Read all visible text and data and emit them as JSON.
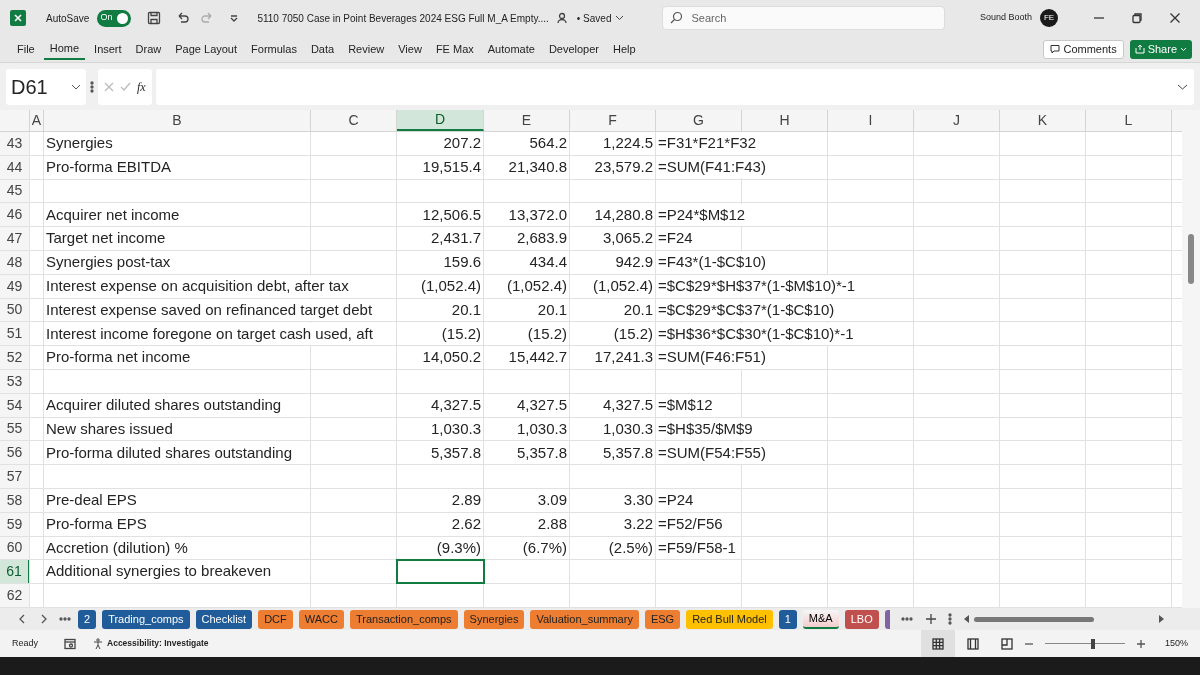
{
  "title_bar": {
    "autosave_label": "AutoSave",
    "autosave_toggle": {
      "label": "On",
      "on": true
    },
    "file_name": "5110 7050 Case in Point Beverages 2024 ESG Full M_A Empty....",
    "save_state": "• Saved",
    "search": {
      "placeholder": "Search"
    },
    "user_name": "Sound Booth",
    "avatar_initials": "FE"
  },
  "ribbon_tabs": [
    {
      "label": "File",
      "selected": false
    },
    {
      "label": "Home",
      "selected": true
    },
    {
      "label": "Insert",
      "selected": false
    },
    {
      "label": "Draw",
      "selected": false
    },
    {
      "label": "Page Layout",
      "selected": false
    },
    {
      "label": "Formulas",
      "selected": false
    },
    {
      "label": "Data",
      "selected": false
    },
    {
      "label": "Review",
      "selected": false
    },
    {
      "label": "View",
      "selected": false
    },
    {
      "label": "FE Max",
      "selected": false
    },
    {
      "label": "Automate",
      "selected": false
    },
    {
      "label": "Developer",
      "selected": false
    },
    {
      "label": "Help",
      "selected": false
    }
  ],
  "ribbon_buttons": {
    "comments": "Comments",
    "share": "Share"
  },
  "formula_bar": {
    "name_box": "D61",
    "fx": "fx"
  },
  "columns": [
    {
      "label": "A",
      "selected": false
    },
    {
      "label": "B",
      "selected": false
    },
    {
      "label": "C",
      "selected": false
    },
    {
      "label": "D",
      "selected": true
    },
    {
      "label": "E",
      "selected": false
    },
    {
      "label": "F",
      "selected": false
    },
    {
      "label": "G",
      "selected": false
    },
    {
      "label": "H",
      "selected": false
    },
    {
      "label": "I",
      "selected": false
    },
    {
      "label": "J",
      "selected": false
    },
    {
      "label": "K",
      "selected": false
    },
    {
      "label": "L",
      "selected": false
    }
  ],
  "rows": [
    {
      "number": "43",
      "selected": false,
      "b": "Synergies",
      "d": "207.2",
      "e": "564.2",
      "f": "1,224.5",
      "g": "=F31*F21*F32"
    },
    {
      "number": "44",
      "selected": false,
      "b": "Pro-forma EBITDA",
      "d": "19,515.4",
      "e": "21,340.8",
      "f": "23,579.2",
      "g": "=SUM(F41:F43)"
    },
    {
      "number": "45",
      "selected": false
    },
    {
      "number": "46",
      "selected": false,
      "b": "Acquirer net income",
      "d": "12,506.5",
      "e": "13,372.0",
      "f": "14,280.8",
      "g": "=P24*$M$12"
    },
    {
      "number": "47",
      "selected": false,
      "b": "Target net income",
      "d": "2,431.7",
      "e": "2,683.9",
      "f": "3,065.2",
      "g": "=F24"
    },
    {
      "number": "48",
      "selected": false,
      "b": "Synergies post-tax",
      "d": "159.6",
      "e": "434.4",
      "f": "942.9",
      "g": "=F43*(1-$C$10)"
    },
    {
      "number": "49",
      "selected": false,
      "b": "Interest expense on acquisition debt, after tax",
      "d": "(1,052.4)",
      "e": "(1,052.4)",
      "f": "(1,052.4)",
      "g": "=$C$29*$H$37*(1-$M$10)*-1"
    },
    {
      "number": "50",
      "selected": false,
      "b": "Interest expense saved on refinanced target debt",
      "d": "20.1",
      "e": "20.1",
      "f": "20.1",
      "g": "=$C$29*$C$37*(1-$C$10)"
    },
    {
      "number": "51",
      "selected": false,
      "b": "Interest income foregone on target cash used, aft",
      "d": "(15.2)",
      "e": "(15.2)",
      "f": "(15.2)",
      "g": "=$H$36*$C$30*(1-$C$10)*-1"
    },
    {
      "number": "52",
      "selected": false,
      "b": "Pro-forma net income",
      "d": "14,050.2",
      "e": "15,442.7",
      "f": "17,241.3",
      "g": "=SUM(F46:F51)"
    },
    {
      "number": "53",
      "selected": false
    },
    {
      "number": "54",
      "selected": false,
      "b": "Acquirer diluted shares outstanding",
      "d": "4,327.5",
      "e": "4,327.5",
      "f": "4,327.5",
      "g": "=$M$12"
    },
    {
      "number": "55",
      "selected": false,
      "b": "New shares issued",
      "d": "1,030.3",
      "e": "1,030.3",
      "f": "1,030.3",
      "g": "=$H$35/$M$9"
    },
    {
      "number": "56",
      "selected": false,
      "b": "Pro-forma diluted shares outstanding",
      "d": "5,357.8",
      "e": "5,357.8",
      "f": "5,357.8",
      "g": "=SUM(F54:F55)"
    },
    {
      "number": "57",
      "selected": false
    },
    {
      "number": "58",
      "selected": false,
      "b": "Pre-deal EPS",
      "d": "2.89",
      "e": "3.09",
      "f": "3.30",
      "g": "=P24"
    },
    {
      "number": "59",
      "selected": false,
      "b": "Pro-forma EPS",
      "d": "2.62",
      "e": "2.88",
      "f": "3.22",
      "g": "=F52/F56"
    },
    {
      "number": "60",
      "selected": false,
      "b": "Accretion (dilution) %",
      "d": "(9.3%)",
      "e": "(6.7%)",
      "f": "(2.5%)",
      "g": "=F59/F58-1"
    },
    {
      "number": "61",
      "selected": true,
      "b": "Additional synergies to breakeven",
      "d_selected": true
    },
    {
      "number": "62",
      "selected": false
    }
  ],
  "sheet_tabs": [
    {
      "label": "2",
      "color": "#1f5c99",
      "selected": false
    },
    {
      "label": "Trading_comps",
      "color": "#1f5c99",
      "selected": false
    },
    {
      "label": "Checklist",
      "color": "#1f5c99",
      "selected": false
    },
    {
      "label": "DCF",
      "color": "#ed7d31",
      "selected": false
    },
    {
      "label": "WACC",
      "color": "#ed7d31",
      "selected": false
    },
    {
      "label": "Transaction_comps",
      "color": "#ed7d31",
      "selected": false
    },
    {
      "label": "Synergies",
      "color": "#ed7d31",
      "selected": false
    },
    {
      "label": "Valuation_summary",
      "color": "#ed7d31",
      "selected": false
    },
    {
      "label": "ESG",
      "color": "#ed7d31",
      "selected": false
    },
    {
      "label": "Red Bull Model",
      "color": "#ffc000",
      "selected": false
    },
    {
      "label": "1",
      "color": "#1f5c99",
      "selected": false
    },
    {
      "label": "M&A",
      "color": "#f4cccc",
      "selected": true
    },
    {
      "label": "LBO",
      "color": "#c0504d",
      "selected": false
    }
  ],
  "status_bar": {
    "ready": "Ready",
    "accessibility": "Accessibility: Investigate",
    "zoom": "150%",
    "zoom_slider": {
      "level": 0.6
    }
  }
}
